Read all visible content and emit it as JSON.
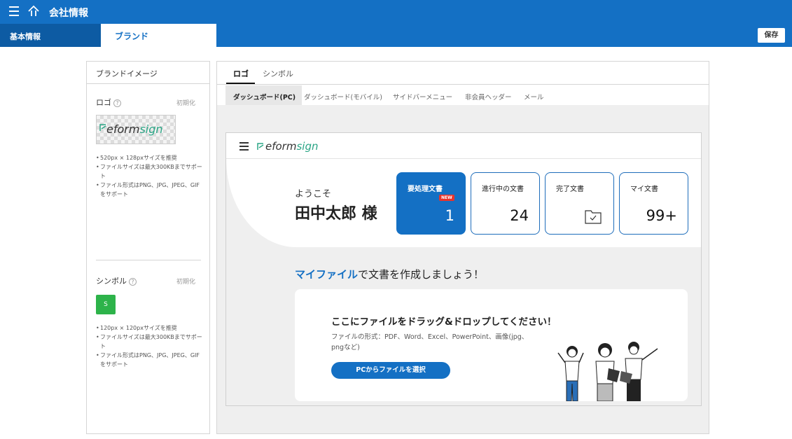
{
  "topbar": {
    "title": "会社情報",
    "menu_icon": "hamburger-menu-icon",
    "home_icon": "home-icon"
  },
  "tabs": {
    "basic": "基本情報",
    "brand": "ブランド"
  },
  "toolbar": {
    "save_label": "保存"
  },
  "colors": {
    "primary": "#1470c4",
    "primary_dark": "#0d5ba3",
    "new_badge": "#e8332b",
    "symbol_green": "#2db34a",
    "logo_accent": "#2aa585"
  },
  "left_panel": {
    "title": "ブランドイメージ",
    "logo": {
      "label": "ロゴ",
      "help": "?",
      "reset": "初期化",
      "logo_text_main": "eform",
      "logo_text_accent": "sign",
      "notes": [
        "520px × 128pxサイズを推奨",
        "ファイルサイズは最大300KBまでサポート",
        "ファイル形式はPNG、JPG、JPEG、GIFをサポート"
      ]
    },
    "symbol": {
      "label": "シンボル",
      "help": "?",
      "reset": "初期化",
      "symbol_letter": "S",
      "notes": [
        "120px × 120pxサイズを推奨",
        "ファイルサイズは最大300KBまでサポート",
        "ファイル形式はPNG、JPG、JPEG、GIFをサポート"
      ]
    }
  },
  "right_panel": {
    "tabs": [
      "ロゴ",
      "シンボル"
    ],
    "sub_tabs": [
      "ダッシュボード(PC)",
      "ダッシュボード(モバイル)",
      "サイドバーメニュー",
      "非会員ヘッダー",
      "メール"
    ],
    "preview": {
      "logo_main": "eform",
      "logo_accent": "sign",
      "welcome": "ようこそ",
      "username": "田中太郎 様",
      "cards": [
        {
          "label": "要処理文書",
          "value": "1",
          "badge": "NEW"
        },
        {
          "label": "進行中の文書",
          "value": "24"
        },
        {
          "label": "完了文書",
          "icon": "folder-check-icon"
        },
        {
          "label": "マイ文書",
          "value": "99+"
        }
      ],
      "myfile_highlight": "マイファイル",
      "myfile_rest": "で文書を作成しましょう！",
      "drop_title": "ここにファイルをドラッグ&ドロップしてください！",
      "drop_formats": "ファイルの形式：PDF、Word、Excel、PowerPoint、画像(jpg、pngなど)",
      "pc_button": "PCからファイルを選択"
    }
  }
}
